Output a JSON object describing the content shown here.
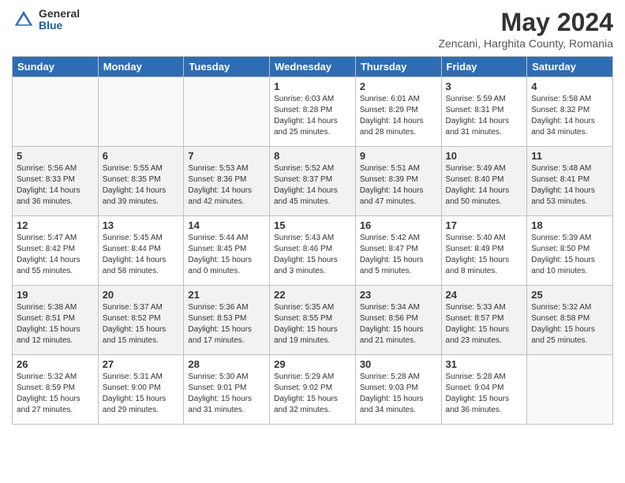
{
  "header": {
    "logo_general": "General",
    "logo_blue": "Blue",
    "title": "May 2024",
    "subtitle": "Zencani, Harghita County, Romania"
  },
  "weekdays": [
    "Sunday",
    "Monday",
    "Tuesday",
    "Wednesday",
    "Thursday",
    "Friday",
    "Saturday"
  ],
  "weeks": [
    [
      {
        "day": "",
        "sunrise": "",
        "sunset": "",
        "daylight": ""
      },
      {
        "day": "",
        "sunrise": "",
        "sunset": "",
        "daylight": ""
      },
      {
        "day": "",
        "sunrise": "",
        "sunset": "",
        "daylight": ""
      },
      {
        "day": "1",
        "sunrise": "Sunrise: 6:03 AM",
        "sunset": "Sunset: 8:28 PM",
        "daylight": "Daylight: 14 hours and 25 minutes."
      },
      {
        "day": "2",
        "sunrise": "Sunrise: 6:01 AM",
        "sunset": "Sunset: 8:29 PM",
        "daylight": "Daylight: 14 hours and 28 minutes."
      },
      {
        "day": "3",
        "sunrise": "Sunrise: 5:59 AM",
        "sunset": "Sunset: 8:31 PM",
        "daylight": "Daylight: 14 hours and 31 minutes."
      },
      {
        "day": "4",
        "sunrise": "Sunrise: 5:58 AM",
        "sunset": "Sunset: 8:32 PM",
        "daylight": "Daylight: 14 hours and 34 minutes."
      }
    ],
    [
      {
        "day": "5",
        "sunrise": "Sunrise: 5:56 AM",
        "sunset": "Sunset: 8:33 PM",
        "daylight": "Daylight: 14 hours and 36 minutes."
      },
      {
        "day": "6",
        "sunrise": "Sunrise: 5:55 AM",
        "sunset": "Sunset: 8:35 PM",
        "daylight": "Daylight: 14 hours and 39 minutes."
      },
      {
        "day": "7",
        "sunrise": "Sunrise: 5:53 AM",
        "sunset": "Sunset: 8:36 PM",
        "daylight": "Daylight: 14 hours and 42 minutes."
      },
      {
        "day": "8",
        "sunrise": "Sunrise: 5:52 AM",
        "sunset": "Sunset: 8:37 PM",
        "daylight": "Daylight: 14 hours and 45 minutes."
      },
      {
        "day": "9",
        "sunrise": "Sunrise: 5:51 AM",
        "sunset": "Sunset: 8:39 PM",
        "daylight": "Daylight: 14 hours and 47 minutes."
      },
      {
        "day": "10",
        "sunrise": "Sunrise: 5:49 AM",
        "sunset": "Sunset: 8:40 PM",
        "daylight": "Daylight: 14 hours and 50 minutes."
      },
      {
        "day": "11",
        "sunrise": "Sunrise: 5:48 AM",
        "sunset": "Sunset: 8:41 PM",
        "daylight": "Daylight: 14 hours and 53 minutes."
      }
    ],
    [
      {
        "day": "12",
        "sunrise": "Sunrise: 5:47 AM",
        "sunset": "Sunset: 8:42 PM",
        "daylight": "Daylight: 14 hours and 55 minutes."
      },
      {
        "day": "13",
        "sunrise": "Sunrise: 5:45 AM",
        "sunset": "Sunset: 8:44 PM",
        "daylight": "Daylight: 14 hours and 58 minutes."
      },
      {
        "day": "14",
        "sunrise": "Sunrise: 5:44 AM",
        "sunset": "Sunset: 8:45 PM",
        "daylight": "Daylight: 15 hours and 0 minutes."
      },
      {
        "day": "15",
        "sunrise": "Sunrise: 5:43 AM",
        "sunset": "Sunset: 8:46 PM",
        "daylight": "Daylight: 15 hours and 3 minutes."
      },
      {
        "day": "16",
        "sunrise": "Sunrise: 5:42 AM",
        "sunset": "Sunset: 8:47 PM",
        "daylight": "Daylight: 15 hours and 5 minutes."
      },
      {
        "day": "17",
        "sunrise": "Sunrise: 5:40 AM",
        "sunset": "Sunset: 8:49 PM",
        "daylight": "Daylight: 15 hours and 8 minutes."
      },
      {
        "day": "18",
        "sunrise": "Sunrise: 5:39 AM",
        "sunset": "Sunset: 8:50 PM",
        "daylight": "Daylight: 15 hours and 10 minutes."
      }
    ],
    [
      {
        "day": "19",
        "sunrise": "Sunrise: 5:38 AM",
        "sunset": "Sunset: 8:51 PM",
        "daylight": "Daylight: 15 hours and 12 minutes."
      },
      {
        "day": "20",
        "sunrise": "Sunrise: 5:37 AM",
        "sunset": "Sunset: 8:52 PM",
        "daylight": "Daylight: 15 hours and 15 minutes."
      },
      {
        "day": "21",
        "sunrise": "Sunrise: 5:36 AM",
        "sunset": "Sunset: 8:53 PM",
        "daylight": "Daylight: 15 hours and 17 minutes."
      },
      {
        "day": "22",
        "sunrise": "Sunrise: 5:35 AM",
        "sunset": "Sunset: 8:55 PM",
        "daylight": "Daylight: 15 hours and 19 minutes."
      },
      {
        "day": "23",
        "sunrise": "Sunrise: 5:34 AM",
        "sunset": "Sunset: 8:56 PM",
        "daylight": "Daylight: 15 hours and 21 minutes."
      },
      {
        "day": "24",
        "sunrise": "Sunrise: 5:33 AM",
        "sunset": "Sunset: 8:57 PM",
        "daylight": "Daylight: 15 hours and 23 minutes."
      },
      {
        "day": "25",
        "sunrise": "Sunrise: 5:32 AM",
        "sunset": "Sunset: 8:58 PM",
        "daylight": "Daylight: 15 hours and 25 minutes."
      }
    ],
    [
      {
        "day": "26",
        "sunrise": "Sunrise: 5:32 AM",
        "sunset": "Sunset: 8:59 PM",
        "daylight": "Daylight: 15 hours and 27 minutes."
      },
      {
        "day": "27",
        "sunrise": "Sunrise: 5:31 AM",
        "sunset": "Sunset: 9:00 PM",
        "daylight": "Daylight: 15 hours and 29 minutes."
      },
      {
        "day": "28",
        "sunrise": "Sunrise: 5:30 AM",
        "sunset": "Sunset: 9:01 PM",
        "daylight": "Daylight: 15 hours and 31 minutes."
      },
      {
        "day": "29",
        "sunrise": "Sunrise: 5:29 AM",
        "sunset": "Sunset: 9:02 PM",
        "daylight": "Daylight: 15 hours and 32 minutes."
      },
      {
        "day": "30",
        "sunrise": "Sunrise: 5:28 AM",
        "sunset": "Sunset: 9:03 PM",
        "daylight": "Daylight: 15 hours and 34 minutes."
      },
      {
        "day": "31",
        "sunrise": "Sunrise: 5:28 AM",
        "sunset": "Sunset: 9:04 PM",
        "daylight": "Daylight: 15 hours and 36 minutes."
      },
      {
        "day": "",
        "sunrise": "",
        "sunset": "",
        "daylight": ""
      }
    ]
  ]
}
